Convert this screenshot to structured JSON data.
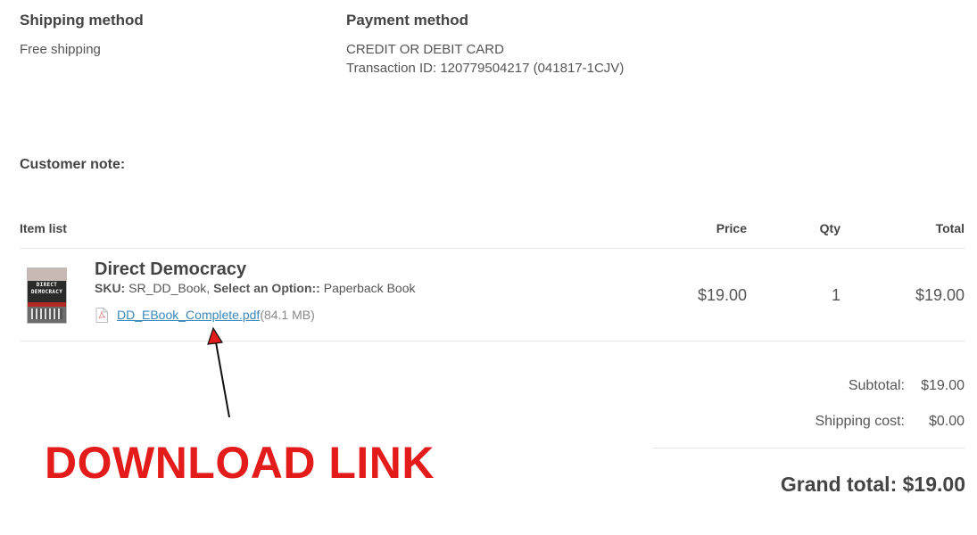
{
  "shipping": {
    "heading": "Shipping method",
    "value": "Free shipping"
  },
  "payment": {
    "heading": "Payment method",
    "method": "CREDIT OR DEBIT CARD",
    "transaction": "Transaction ID: 120779504217 (041817-1CJV)"
  },
  "customer_note": {
    "label": "Customer note:"
  },
  "table": {
    "headers": {
      "item": "Item list",
      "price": "Price",
      "qty": "Qty",
      "total": "Total"
    },
    "item": {
      "cover_line1": "DIRECT",
      "cover_line2": "DEMOCRACY",
      "name": "Direct Democracy",
      "sku_label": "SKU:",
      "sku": "SR_DD_Book,",
      "option_label": "Select an Option::",
      "option": "Paperback Book",
      "file_name": "DD_EBook_Complete.pdf",
      "file_size": "(84.1 MB)",
      "price": "$19.00",
      "qty": "1",
      "total": "$19.00"
    }
  },
  "totals": {
    "subtotal_label": "Subtotal:",
    "subtotal": "$19.00",
    "shipping_label": "Shipping cost:",
    "shipping": "$0.00",
    "grand_total_label": "Grand total:",
    "grand_total": "$19.00"
  },
  "annotation": {
    "text": "DOWNLOAD LINK",
    "color": "#e31b1b"
  }
}
